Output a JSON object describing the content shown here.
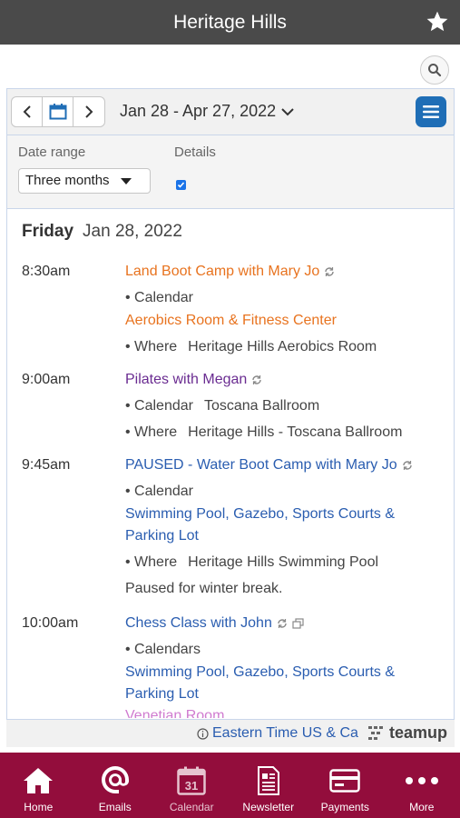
{
  "app": {
    "title": "Heritage Hills"
  },
  "toolbar": {
    "date_range": "Jan 28 - Apr 27, 2022"
  },
  "settings": {
    "date_range_label": "Date range",
    "date_range_value": "Three months",
    "details_label": "Details",
    "details_checked": true
  },
  "day": {
    "weekday": "Friday",
    "date": "Jan 28, 2022"
  },
  "events": [
    {
      "time": "8:30am",
      "title": "Land Boot Camp with Mary Jo",
      "calendar_label": "• Calendar",
      "calendar": "Aerobics Room & Fitness Center",
      "where_label": "• Where",
      "where": "Heritage Hills Aerobics Room",
      "color": "#e8731f"
    },
    {
      "time": "9:00am",
      "title": "Pilates with Megan",
      "calendar_label": "• Calendar",
      "calendar": "Toscana Ballroom",
      "where_label": "• Where",
      "where": "Heritage Hills - Toscana Ballroom",
      "color": "#6a2c91"
    },
    {
      "time": "9:45am",
      "title": "PAUSED - Water Boot Camp with Mary Jo",
      "calendar_label": "• Calendar",
      "calendar_line1": "Swimming Pool, Gazebo, Sports Courts &",
      "calendar_line2": "Parking Lot",
      "where_label": "• Where",
      "where": "Heritage Hills Swimming Pool",
      "note": "Paused for winter break.",
      "color": "#2a5db0"
    },
    {
      "time": "10:00am",
      "title": "Chess Class with John",
      "calendar_label": "• Calendars",
      "calendar_line1": "Swimming Pool, Gazebo, Sports Courts &",
      "calendar_line2": "Parking Lot",
      "calendar_line3": "Venetian Room",
      "color": "#2a5db0"
    }
  ],
  "footer": {
    "timezone": "Eastern Time US & Ca",
    "brand": "teamup"
  },
  "bottom_nav": [
    {
      "label": "Home",
      "icon": "home-icon"
    },
    {
      "label": "Emails",
      "icon": "email-icon"
    },
    {
      "label": "Calendar",
      "icon": "calendar-icon",
      "day": "31"
    },
    {
      "label": "Newsletter",
      "icon": "newsletter-icon"
    },
    {
      "label": "Payments",
      "icon": "payment-card-icon"
    },
    {
      "label": "More",
      "icon": "more-dots-icon"
    }
  ],
  "colors": {
    "topbar": "#4a4a4a",
    "bottombar": "#930d3c",
    "accent": "#1f6eb6"
  }
}
